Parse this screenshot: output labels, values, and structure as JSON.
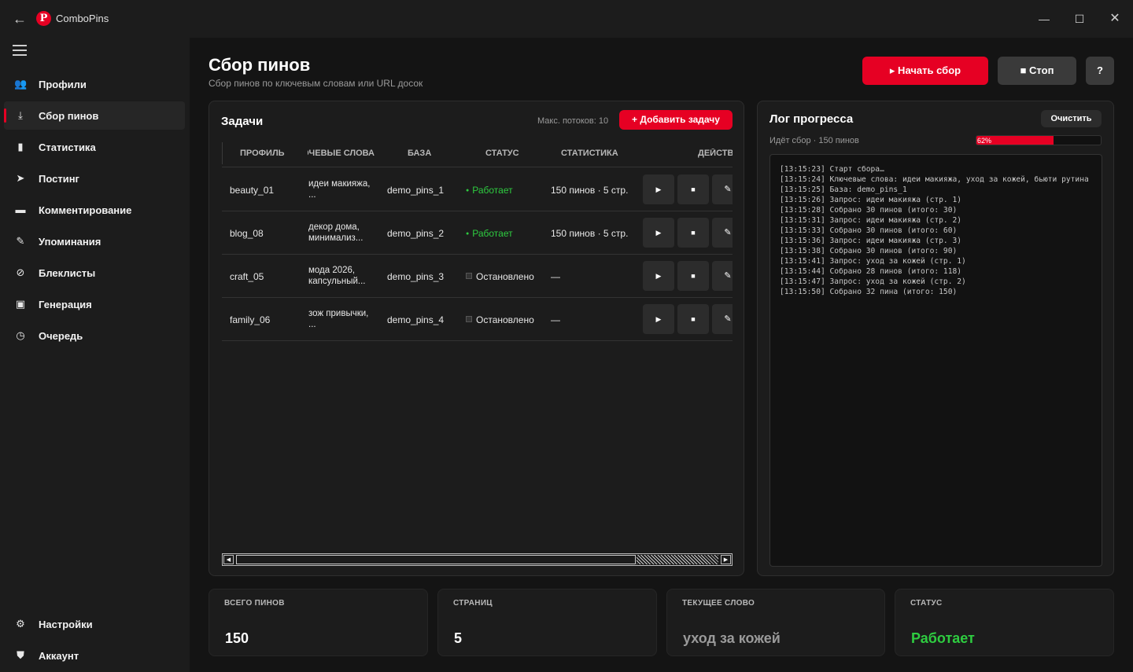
{
  "app": {
    "title": "ComboPins",
    "logo_glyph": "P"
  },
  "sidebar": {
    "items": [
      {
        "label": "Профили",
        "icon": "users-icon"
      },
      {
        "label": "Сбор пинов",
        "icon": "download-icon",
        "active": true
      },
      {
        "label": "Статистика",
        "icon": "bar-chart-icon"
      },
      {
        "label": "Постинг",
        "icon": "send-icon"
      },
      {
        "label": "Комментирование",
        "icon": "comment-icon"
      },
      {
        "label": "Упоминания",
        "icon": "pencil-icon"
      },
      {
        "label": "Блеклисты",
        "icon": "block-icon"
      },
      {
        "label": "Генерация",
        "icon": "image-icon"
      },
      {
        "label": "Очередь",
        "icon": "clock-icon"
      }
    ],
    "bottom": [
      {
        "label": "Настройки",
        "icon": "gear-icon"
      },
      {
        "label": "Аккаунт",
        "icon": "shield-icon"
      }
    ]
  },
  "header": {
    "title": "Сбор пинов",
    "subtitle": "Сбор пинов по ключевым словам или URL досок",
    "start_label": "▸ Начать сбор",
    "stop_label": "■ Стоп",
    "help_label": "?"
  },
  "tasks": {
    "title": "Задачи",
    "max_threads": "Макс. потоков: 10",
    "add_label": "+ Добавить задачу",
    "columns": [
      "ПРОФИЛЬ",
      "КЛЮЧЕВЫЕ СЛОВА",
      "БАЗА",
      "СТАТУС",
      "СТАТИСТИКА",
      "ДЕЙСТВИЯ"
    ],
    "rows": [
      {
        "profile": "beauty_01",
        "keywords": "идеи макияжа, ...",
        "base": "demo_pins_1",
        "status": "Работает",
        "running": true,
        "stats": "150 пинов · 5 стр."
      },
      {
        "profile": "blog_08",
        "keywords": "декор дома, минимализ...",
        "base": "demo_pins_2",
        "status": "Работает",
        "running": true,
        "stats": "150 пинов · 5 стр."
      },
      {
        "profile": "craft_05",
        "keywords": "мода 2026, капсульный...",
        "base": "demo_pins_3",
        "status": "Остановлено",
        "running": false,
        "stats": "—"
      },
      {
        "profile": "family_06",
        "keywords": "зож привычки, ...",
        "base": "demo_pins_4",
        "status": "Остановлено",
        "running": false,
        "stats": "—"
      }
    ]
  },
  "log": {
    "title": "Лог прогресса",
    "clear_label": "Очистить",
    "status": "Идёт сбор · 150 пинов",
    "progress": 0.62,
    "progress_label": "62%",
    "lines": [
      "[13:15:23] Старт сбора…",
      "[13:15:24] Ключевые слова: идеи макияжа, уход за кожей, бьюти рутина",
      "[13:15:25] База: demo_pins_1",
      "[13:15:26] Запрос: идеи макияжа (стр. 1)",
      "[13:15:28] Собрано 30 пинов (итого: 30)",
      "[13:15:31] Запрос: идеи макияжа (стр. 2)",
      "[13:15:33] Собрано 30 пинов (итого: 60)",
      "[13:15:36] Запрос: идеи макияжа (стр. 3)",
      "[13:15:38] Собрано 30 пинов (итого: 90)",
      "[13:15:41] Запрос: уход за кожей (стр. 1)",
      "[13:15:44] Собрано 28 пинов (итого: 118)",
      "[13:15:47] Запрос: уход за кожей (стр. 2)",
      "[13:15:50] Собрано 32 пина (итого: 150)"
    ]
  },
  "stats": [
    {
      "label": "ВСЕГО ПИНОВ",
      "value": "150",
      "color": "#ffffff"
    },
    {
      "label": "СТРАНИЦ",
      "value": "5",
      "color": "#ffffff"
    },
    {
      "label": "ТЕКУЩЕЕ СЛОВО",
      "value": "уход за кожей",
      "color": "#9a9a9a"
    },
    {
      "label": "СТАТУС",
      "value": "Работает",
      "color": "#2ecc40"
    }
  ],
  "colors": {
    "accent": "#e60023",
    "running": "#2ecc40"
  }
}
